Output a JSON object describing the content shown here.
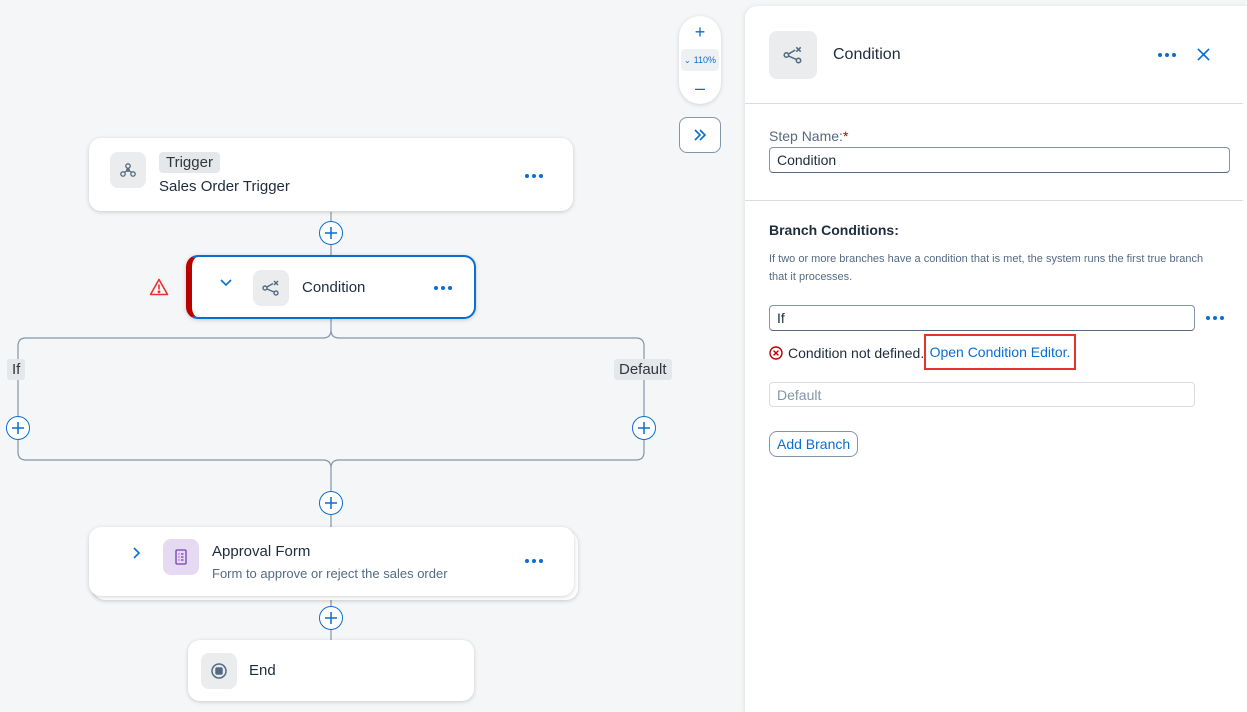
{
  "canvas": {
    "zoom": {
      "zoom_in_label": "+",
      "level": "110%",
      "zoom_out_label": "–"
    },
    "trigger_node": {
      "tag": "Trigger",
      "title": "Sales Order Trigger"
    },
    "condition_node": {
      "title": "Condition",
      "status": "error"
    },
    "branches": {
      "left_label": "If",
      "right_label": "Default"
    },
    "approval_node": {
      "title": "Approval Form",
      "subtitle": "Form to approve or reject the sales order"
    },
    "end_node": {
      "title": "End"
    }
  },
  "panel": {
    "title": "Condition",
    "step_name": {
      "label": "Step Name:",
      "required_mark": "*",
      "value": "Condition"
    },
    "branch_conditions": {
      "title": "Branch Conditions:",
      "description": "If two or more branches have a condition that is met, the system runs the first true branch that it processes.",
      "if_branch_value": "If",
      "error_text": "Condition not defined.",
      "editor_link": "Open Condition Editor.",
      "default_placeholder": "Default",
      "add_branch_label": "Add Branch"
    }
  },
  "colors": {
    "accent": "#0a6ed1",
    "error": "#bb0000",
    "warning": "#e9322d",
    "approval_icon_bg": "#e6d9f2"
  },
  "icons": {
    "trigger": "trigger-network-icon",
    "condition": "condition-split-icon",
    "approval": "form-document-icon",
    "end": "stop-icon"
  }
}
